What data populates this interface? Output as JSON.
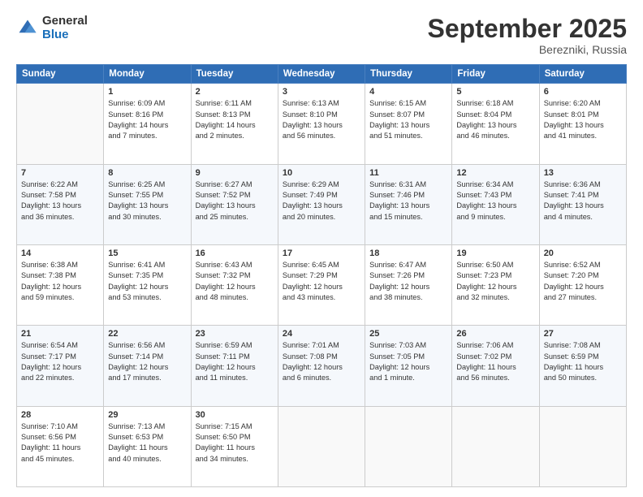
{
  "logo": {
    "general": "General",
    "blue": "Blue"
  },
  "header": {
    "month": "September 2025",
    "location": "Berezniki, Russia"
  },
  "days_of_week": [
    "Sunday",
    "Monday",
    "Tuesday",
    "Wednesday",
    "Thursday",
    "Friday",
    "Saturday"
  ],
  "weeks": [
    [
      {
        "day": "",
        "info": ""
      },
      {
        "day": "1",
        "info": "Sunrise: 6:09 AM\nSunset: 8:16 PM\nDaylight: 14 hours\nand 7 minutes."
      },
      {
        "day": "2",
        "info": "Sunrise: 6:11 AM\nSunset: 8:13 PM\nDaylight: 14 hours\nand 2 minutes."
      },
      {
        "day": "3",
        "info": "Sunrise: 6:13 AM\nSunset: 8:10 PM\nDaylight: 13 hours\nand 56 minutes."
      },
      {
        "day": "4",
        "info": "Sunrise: 6:15 AM\nSunset: 8:07 PM\nDaylight: 13 hours\nand 51 minutes."
      },
      {
        "day": "5",
        "info": "Sunrise: 6:18 AM\nSunset: 8:04 PM\nDaylight: 13 hours\nand 46 minutes."
      },
      {
        "day": "6",
        "info": "Sunrise: 6:20 AM\nSunset: 8:01 PM\nDaylight: 13 hours\nand 41 minutes."
      }
    ],
    [
      {
        "day": "7",
        "info": "Sunrise: 6:22 AM\nSunset: 7:58 PM\nDaylight: 13 hours\nand 36 minutes."
      },
      {
        "day": "8",
        "info": "Sunrise: 6:25 AM\nSunset: 7:55 PM\nDaylight: 13 hours\nand 30 minutes."
      },
      {
        "day": "9",
        "info": "Sunrise: 6:27 AM\nSunset: 7:52 PM\nDaylight: 13 hours\nand 25 minutes."
      },
      {
        "day": "10",
        "info": "Sunrise: 6:29 AM\nSunset: 7:49 PM\nDaylight: 13 hours\nand 20 minutes."
      },
      {
        "day": "11",
        "info": "Sunrise: 6:31 AM\nSunset: 7:46 PM\nDaylight: 13 hours\nand 15 minutes."
      },
      {
        "day": "12",
        "info": "Sunrise: 6:34 AM\nSunset: 7:43 PM\nDaylight: 13 hours\nand 9 minutes."
      },
      {
        "day": "13",
        "info": "Sunrise: 6:36 AM\nSunset: 7:41 PM\nDaylight: 13 hours\nand 4 minutes."
      }
    ],
    [
      {
        "day": "14",
        "info": "Sunrise: 6:38 AM\nSunset: 7:38 PM\nDaylight: 12 hours\nand 59 minutes."
      },
      {
        "day": "15",
        "info": "Sunrise: 6:41 AM\nSunset: 7:35 PM\nDaylight: 12 hours\nand 53 minutes."
      },
      {
        "day": "16",
        "info": "Sunrise: 6:43 AM\nSunset: 7:32 PM\nDaylight: 12 hours\nand 48 minutes."
      },
      {
        "day": "17",
        "info": "Sunrise: 6:45 AM\nSunset: 7:29 PM\nDaylight: 12 hours\nand 43 minutes."
      },
      {
        "day": "18",
        "info": "Sunrise: 6:47 AM\nSunset: 7:26 PM\nDaylight: 12 hours\nand 38 minutes."
      },
      {
        "day": "19",
        "info": "Sunrise: 6:50 AM\nSunset: 7:23 PM\nDaylight: 12 hours\nand 32 minutes."
      },
      {
        "day": "20",
        "info": "Sunrise: 6:52 AM\nSunset: 7:20 PM\nDaylight: 12 hours\nand 27 minutes."
      }
    ],
    [
      {
        "day": "21",
        "info": "Sunrise: 6:54 AM\nSunset: 7:17 PM\nDaylight: 12 hours\nand 22 minutes."
      },
      {
        "day": "22",
        "info": "Sunrise: 6:56 AM\nSunset: 7:14 PM\nDaylight: 12 hours\nand 17 minutes."
      },
      {
        "day": "23",
        "info": "Sunrise: 6:59 AM\nSunset: 7:11 PM\nDaylight: 12 hours\nand 11 minutes."
      },
      {
        "day": "24",
        "info": "Sunrise: 7:01 AM\nSunset: 7:08 PM\nDaylight: 12 hours\nand 6 minutes."
      },
      {
        "day": "25",
        "info": "Sunrise: 7:03 AM\nSunset: 7:05 PM\nDaylight: 12 hours\nand 1 minute."
      },
      {
        "day": "26",
        "info": "Sunrise: 7:06 AM\nSunset: 7:02 PM\nDaylight: 11 hours\nand 56 minutes."
      },
      {
        "day": "27",
        "info": "Sunrise: 7:08 AM\nSunset: 6:59 PM\nDaylight: 11 hours\nand 50 minutes."
      }
    ],
    [
      {
        "day": "28",
        "info": "Sunrise: 7:10 AM\nSunset: 6:56 PM\nDaylight: 11 hours\nand 45 minutes."
      },
      {
        "day": "29",
        "info": "Sunrise: 7:13 AM\nSunset: 6:53 PM\nDaylight: 11 hours\nand 40 minutes."
      },
      {
        "day": "30",
        "info": "Sunrise: 7:15 AM\nSunset: 6:50 PM\nDaylight: 11 hours\nand 34 minutes."
      },
      {
        "day": "",
        "info": ""
      },
      {
        "day": "",
        "info": ""
      },
      {
        "day": "",
        "info": ""
      },
      {
        "day": "",
        "info": ""
      }
    ]
  ]
}
